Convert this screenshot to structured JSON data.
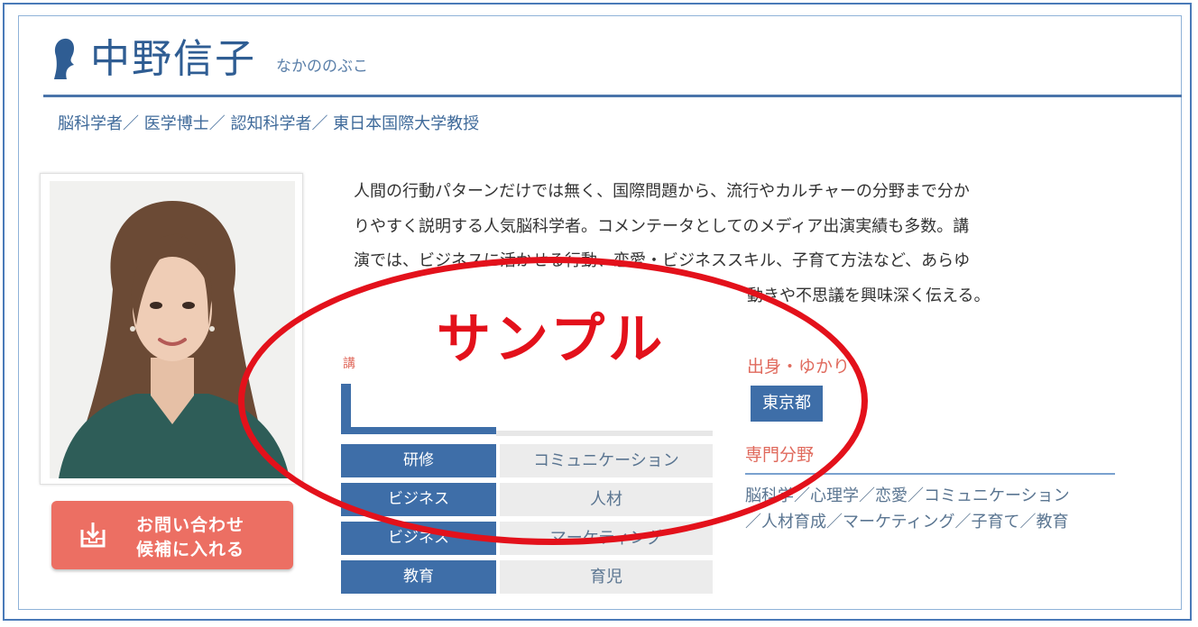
{
  "profile": {
    "name": "中野信子",
    "kana": "なかののぶこ",
    "titles": "脳科学者／ 医学博士／ 認知科学者／ 東日本国際大学教授",
    "bio_lines": [
      "人間の行動パターンだけでは無く、国際問題から、流行やカルチャーの分野まで分か",
      "りやすく説明する人気脳科学者。コメンテータとしてのメディア出演実績も多数。講",
      "演では、ビジネスに活かせる行動、恋愛・ビジネススキル、子育て方法など、あらゆ",
      "動きや不思議を興味深く伝える。"
    ]
  },
  "contact_button": {
    "line1": "お問い合わせ",
    "line2": "候補に入れる",
    "icon": "download-tray-icon"
  },
  "lecture": {
    "heading": "講",
    "rows": [
      {
        "category": "研修",
        "topic": "コミュニケーション"
      },
      {
        "category": "ビジネス",
        "topic": "人材"
      },
      {
        "category": "ビジネス",
        "topic": "マーケティング"
      },
      {
        "category": "教育",
        "topic": "育児"
      }
    ]
  },
  "origin": {
    "heading": "出身・ゆかり",
    "tag": "東京都"
  },
  "specialty": {
    "heading": "専門分野",
    "line1": "脳科学／心理学／恋愛／コミュニケーション",
    "line2": "／人材育成／マーケティング／子育て／教育"
  },
  "watermark": {
    "text": "サンプル",
    "color": "#e3111b"
  },
  "colors": {
    "brand_blue": "#3e6ea8",
    "accent_red": "#e06a5d",
    "button_red": "#ec6f63"
  }
}
